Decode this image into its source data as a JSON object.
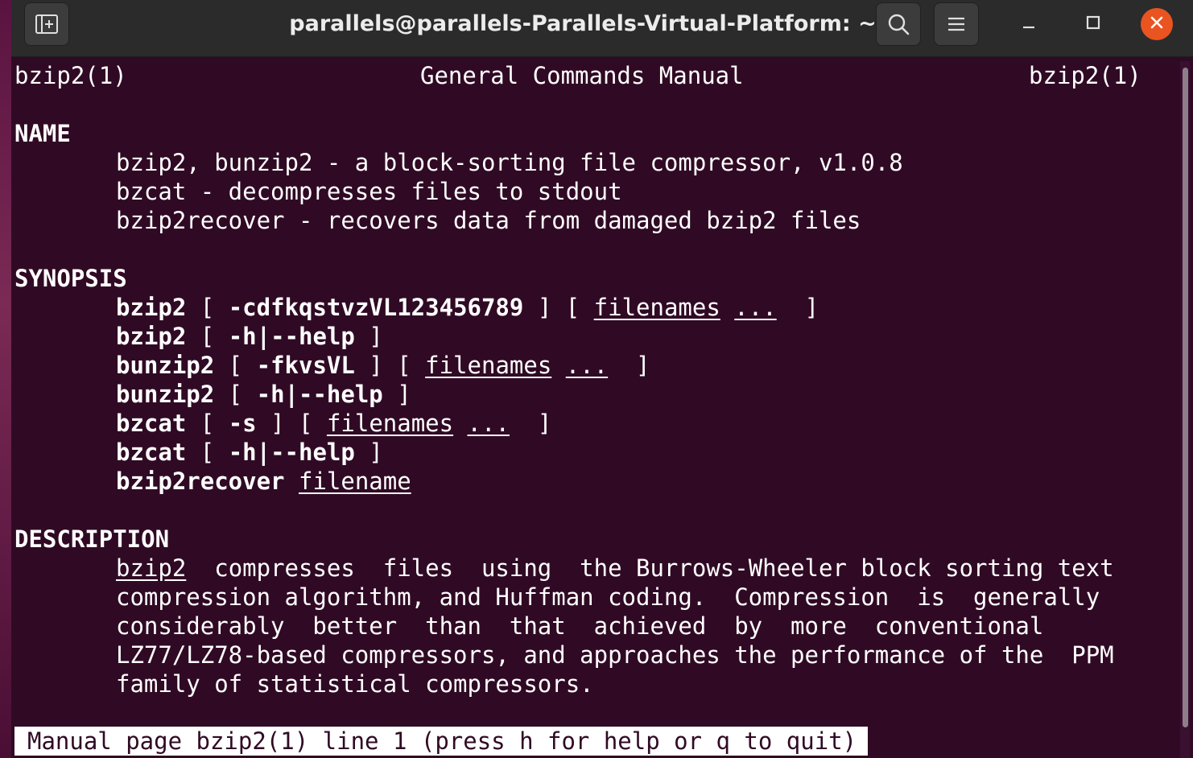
{
  "window": {
    "title": "parallels@parallels-Parallels-Virtual-Platform: ~",
    "buttons": {
      "new_tab_icon": "new-tab-icon",
      "search_icon": "search-icon",
      "menu_icon": "hamburger-menu-icon",
      "minimize_icon": "minimize-icon",
      "maximize_icon": "maximize-icon",
      "close_icon": "close-icon"
    },
    "accent_color": "#e95420",
    "terminal_bg": "#300a24"
  },
  "man": {
    "header_left": "bzip2(1)",
    "header_center": "General Commands Manual",
    "header_right": "bzip2(1)",
    "name_heading": "NAME",
    "name_lines": [
      "bzip2, bunzip2 - a block-sorting file compressor, v1.0.8",
      "bzcat - decompresses files to stdout",
      "bzip2recover - recovers data from damaged bzip2 files"
    ],
    "synopsis_heading": "SYNOPSIS",
    "synopsis": [
      {
        "cmd": "bzip2",
        "br1": " [ ",
        "opt": "-cdfkqstvzVL123456789",
        "br2": " ] [ ",
        "arg": "filenames",
        "sp": " ",
        "ell": "...",
        "br3": "  ]"
      },
      {
        "cmd": "bzip2",
        "br1": " [ ",
        "opt": "-h|--help",
        "br2": " ]"
      },
      {
        "cmd": "bunzip2",
        "br1": " [ ",
        "opt": "-fkvsVL",
        "br2": " ] [ ",
        "arg": "filenames",
        "sp": " ",
        "ell": "...",
        "br3": "  ]"
      },
      {
        "cmd": "bunzip2",
        "br1": " [ ",
        "opt": "-h|--help",
        "br2": " ]"
      },
      {
        "cmd": "bzcat",
        "br1": " [ ",
        "opt": "-s",
        "br2": " ] [ ",
        "arg": "filenames",
        "sp": " ",
        "ell": "...",
        "br3": "  ]"
      },
      {
        "cmd": "bzcat",
        "br1": " [ ",
        "opt": "-h|--help",
        "br2": " ]"
      },
      {
        "cmd": "bzip2recover",
        "sp": " ",
        "arg": "filename"
      }
    ],
    "description_heading": "DESCRIPTION",
    "description_first_word": "bzip2",
    "description_lines": [
      "  compresses  files  using  the Burrows-Wheeler block sorting text",
      "compression algorithm, and Huffman coding.  Compression  is  generally",
      "considerably  better  than  that  achieved  by  more  conventional",
      "LZ77/LZ78-based compressors, and approaches the performance of the  PPM",
      "family of statistical compressors."
    ],
    "status_line": "Manual page bzip2(1) line 1 (press h for help or q to quit)"
  }
}
